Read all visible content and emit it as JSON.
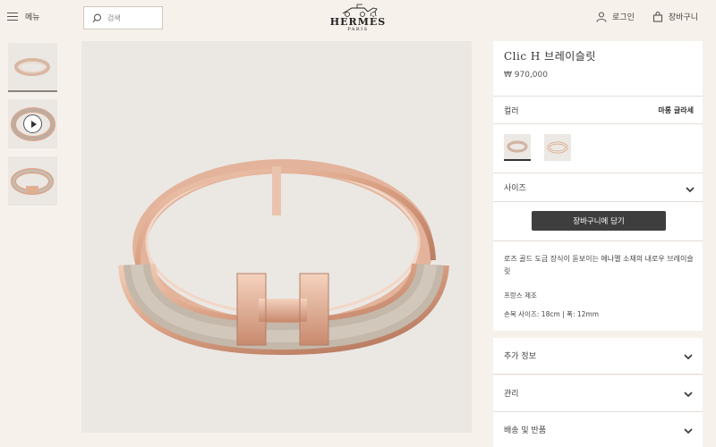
{
  "header": {
    "menu_label": "메뉴",
    "search_placeholder": "검색",
    "logo_name": "HERMÈS",
    "logo_city": "PARIS",
    "login_label": "로그인",
    "cart_label": "장바구니"
  },
  "product": {
    "title": "Clic H 브레이슬릿",
    "price": "₩ 970,000",
    "color_label": "컬러",
    "color_value": "마롱 글라세",
    "size_label": "사이즈",
    "add_to_cart": "장바구니에 담기",
    "description": "로즈 골드 도금 장식이 돋보이는 에나멜 소재의 내로우 브레이슬릿",
    "made_in": "프랑스 제조",
    "dimensions": "손목 사이즈: 18cm | 폭: 12mm"
  },
  "accordion": [
    {
      "label": "추가 정보"
    },
    {
      "label": "관리"
    },
    {
      "label": "배송 및 반품"
    }
  ],
  "colors": {
    "accent": "#3e3e3e",
    "background": "#f6f1eb",
    "rose_gold": "#e2b59a",
    "enamel": "#c9bfb2"
  },
  "icons": [
    "menu-icon",
    "search-icon",
    "user-icon",
    "bag-icon",
    "play-icon",
    "chevron-down-icon"
  ]
}
